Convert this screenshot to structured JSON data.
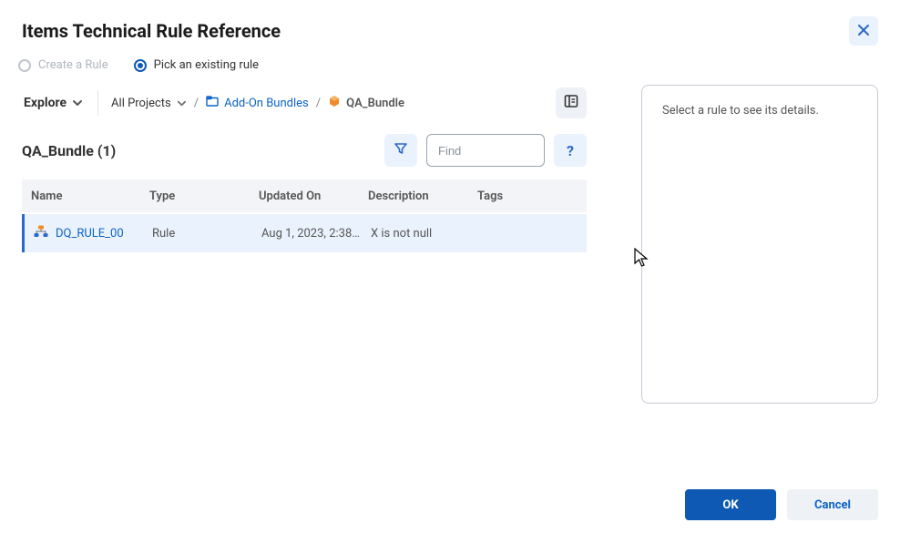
{
  "dialog": {
    "title": "Items Technical Rule Reference"
  },
  "radios": {
    "create_label": "Create a Rule",
    "pick_label": "Pick an existing rule"
  },
  "explore": {
    "label": "Explore"
  },
  "breadcrumb": {
    "all_label": "All Projects",
    "link_label": "Add-On Bundles",
    "current_label": "QA_Bundle"
  },
  "section": {
    "title": "QA_Bundle (1)"
  },
  "search": {
    "placeholder": "Find"
  },
  "columns": {
    "name": "Name",
    "type": "Type",
    "updated": "Updated On",
    "description": "Description",
    "tags": "Tags"
  },
  "rows": [
    {
      "name": "DQ_RULE_00",
      "type": "Rule",
      "updated": "Aug 1, 2023, 2:38…",
      "description": "X is not null",
      "tags": ""
    }
  ],
  "details": {
    "placeholder": "Select a rule to see its details."
  },
  "footer": {
    "ok": "OK",
    "cancel": "Cancel"
  }
}
